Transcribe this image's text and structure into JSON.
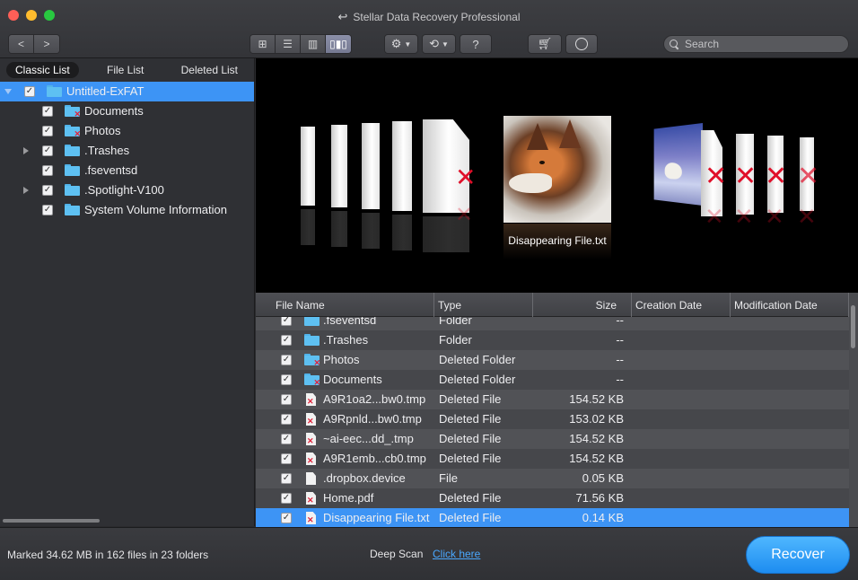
{
  "window": {
    "title": "Stellar Data Recovery Professional"
  },
  "toolbar": {
    "nav_back": "<",
    "nav_forward": ">",
    "help_label": "?",
    "search_placeholder": "Search"
  },
  "sidebar": {
    "tabs": [
      {
        "label": "Classic List",
        "active": true
      },
      {
        "label": "File List",
        "active": false
      },
      {
        "label": "Deleted List",
        "active": false
      }
    ],
    "tree": [
      {
        "label": "Untitled-ExFAT",
        "level": 0,
        "expanded": true,
        "checked": true,
        "selected": true,
        "deleted": false
      },
      {
        "label": "Documents",
        "level": 1,
        "checked": true,
        "deleted": true
      },
      {
        "label": "Photos",
        "level": 1,
        "checked": true,
        "deleted": true
      },
      {
        "label": ".Trashes",
        "level": 1,
        "checked": true,
        "expandable": true,
        "deleted": false
      },
      {
        "label": ".fseventsd",
        "level": 1,
        "checked": true,
        "deleted": false
      },
      {
        "label": ".Spotlight-V100",
        "level": 1,
        "checked": true,
        "expandable": true,
        "deleted": false
      },
      {
        "label": "System Volume Information",
        "level": 1,
        "checked": true,
        "deleted": false
      }
    ]
  },
  "preview": {
    "caption": "Disappearing File.txt"
  },
  "table": {
    "columns": [
      "File Name",
      "Type",
      "Size",
      "Creation Date",
      "Modification Date"
    ],
    "rows": [
      {
        "name": ".fseventsd",
        "type": "Folder",
        "size": "--",
        "icon": "folder",
        "deleted": false
      },
      {
        "name": ".Trashes",
        "type": "Folder",
        "size": "--",
        "icon": "folder",
        "deleted": false
      },
      {
        "name": "Photos",
        "type": "Deleted Folder",
        "size": "--",
        "icon": "folder",
        "deleted": true
      },
      {
        "name": "Documents",
        "type": "Deleted Folder",
        "size": "--",
        "icon": "folder",
        "deleted": true
      },
      {
        "name": "A9R1oa2...bw0.tmp",
        "type": "Deleted File",
        "size": "154.52 KB",
        "icon": "file",
        "deleted": true
      },
      {
        "name": "A9Rpnld...bw0.tmp",
        "type": "Deleted File",
        "size": "153.02 KB",
        "icon": "file",
        "deleted": true
      },
      {
        "name": "~ai-eec...dd_.tmp",
        "type": "Deleted File",
        "size": "154.52 KB",
        "icon": "file",
        "deleted": true
      },
      {
        "name": "A9R1emb...cb0.tmp",
        "type": "Deleted File",
        "size": "154.52 KB",
        "icon": "file",
        "deleted": true
      },
      {
        "name": ".dropbox.device",
        "type": "File",
        "size": "0.05 KB",
        "icon": "file",
        "deleted": false
      },
      {
        "name": "Home.pdf",
        "type": "Deleted File",
        "size": "71.56 KB",
        "icon": "file",
        "deleted": true
      },
      {
        "name": "Disappearing File.txt",
        "type": "Deleted File",
        "size": "0.14 KB",
        "icon": "file",
        "deleted": true,
        "selected": true
      }
    ]
  },
  "footer": {
    "status": "Marked 34.62 MB in 162 files in 23 folders",
    "deep_scan_label": "Deep Scan",
    "deep_scan_link": "Click here",
    "recover_label": "Recover"
  },
  "colors": {
    "accent": "#3d94f5",
    "deleted_mark": "#e0223a",
    "link": "#4aa8ff"
  }
}
